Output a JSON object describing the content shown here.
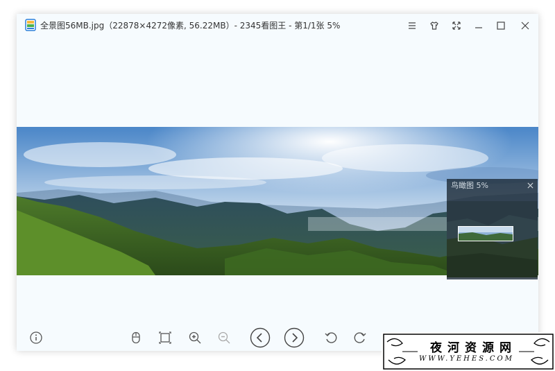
{
  "window": {
    "title": "全景图56MB.jpg（22878×4272像素, 56.22MB）- 2345看图王 - 第1/1张 5%",
    "app_icon": "app-logo-icon"
  },
  "titlebar_buttons": [
    {
      "name": "menu-button",
      "icon": "hamburger-menu-icon"
    },
    {
      "name": "skin-button",
      "icon": "shirt-icon"
    },
    {
      "name": "fullscreen-button",
      "icon": "expand-arrows-icon"
    },
    {
      "name": "minimize-button",
      "icon": "minimize-icon"
    },
    {
      "name": "maximize-button",
      "icon": "maximize-icon"
    },
    {
      "name": "close-button",
      "icon": "close-icon"
    }
  ],
  "birdseye": {
    "label": "鸟瞰图 5%",
    "close_icon": "close-icon"
  },
  "toolbar": [
    {
      "name": "info-button",
      "icon": "info-icon"
    },
    {
      "name": "mouse-mode-button",
      "icon": "mouse-icon"
    },
    {
      "name": "fit-screen-button",
      "icon": "fit-frame-icon"
    },
    {
      "name": "zoom-in-button",
      "icon": "zoom-in-icon"
    },
    {
      "name": "zoom-out-button",
      "icon": "zoom-out-icon"
    },
    {
      "name": "prev-image-button",
      "icon": "chevron-left-icon"
    },
    {
      "name": "next-image-button",
      "icon": "chevron-right-icon"
    },
    {
      "name": "rotate-left-button",
      "icon": "rotate-ccw-icon"
    },
    {
      "name": "rotate-right-button",
      "icon": "rotate-cw-icon"
    }
  ],
  "watermark": {
    "text": "夜河资源网",
    "url": "WWW.YEHES.COM"
  },
  "colors": {
    "window_bg": "#f6fbfe",
    "icon_stroke": "#555555",
    "birdseye_bg": "#192632"
  }
}
